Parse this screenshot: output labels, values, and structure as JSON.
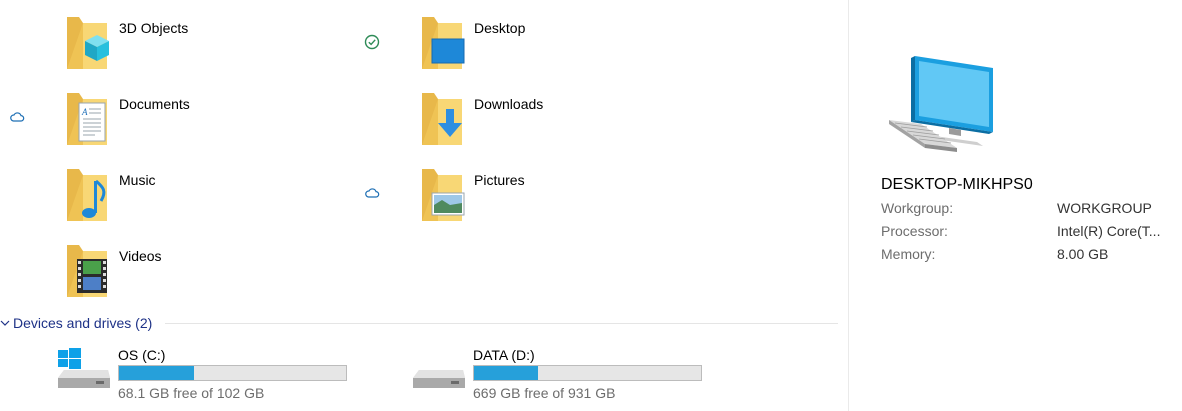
{
  "folders": [
    {
      "name": "3D Objects",
      "status": null,
      "icon": "3d-objects-folder-icon"
    },
    {
      "name": "Desktop",
      "status": "synced",
      "icon": "desktop-folder-icon"
    },
    {
      "name": "Documents",
      "status": "cloud",
      "icon": "documents-folder-icon"
    },
    {
      "name": "Downloads",
      "status": null,
      "icon": "downloads-folder-icon"
    },
    {
      "name": "Music",
      "status": null,
      "icon": "music-folder-icon"
    },
    {
      "name": "Pictures",
      "status": "cloud",
      "icon": "pictures-folder-icon"
    },
    {
      "name": "Videos",
      "status": null,
      "icon": "videos-folder-icon"
    }
  ],
  "devices_section": {
    "title": "Devices and drives (2)"
  },
  "drives": [
    {
      "name": "OS (C:)",
      "free_text": "68.1 GB free of 102 GB",
      "used_fraction": 0.332,
      "icon": "windows-drive-icon"
    },
    {
      "name": "DATA (D:)",
      "free_text": "669 GB free of 931 GB",
      "used_fraction": 0.281,
      "icon": "hard-drive-icon"
    }
  ],
  "details": {
    "computer_name": "DESKTOP-MIKHPS0",
    "properties": [
      {
        "label": "Workgroup:",
        "value": "WORKGROUP"
      },
      {
        "label": "Processor:",
        "value": "Intel(R) Core(T..."
      },
      {
        "label": "Memory:",
        "value": "8.00 GB"
      }
    ]
  },
  "colors": {
    "accent": "#26a0da",
    "section_title": "#1e3287",
    "folder_yellow": "#f8d775",
    "sync_green": "#2e8b57",
    "cloud_blue": "#1e6fb4"
  }
}
